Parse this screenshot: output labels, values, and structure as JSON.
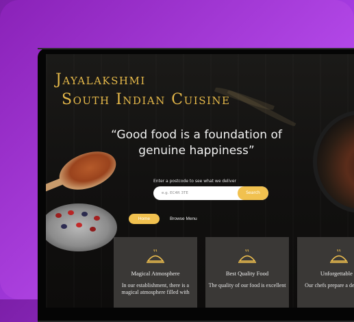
{
  "brand": {
    "line1": "Jayalakshmi",
    "line2": "South Indian Cuisine"
  },
  "hero": {
    "quote": "“Good food is a foundation of genuine happiness”"
  },
  "delivery": {
    "label": "Enter a postcode to see what we deliver",
    "placeholder": "e.g. EC4R 3TE",
    "button": "Search"
  },
  "nav": {
    "home": "Home",
    "browse": "Browse Menu"
  },
  "features": [
    {
      "icon": "cloche-icon",
      "title": "Magical Atmosphere",
      "desc": "In our establishment, there is a magical atmosphere filled with"
    },
    {
      "icon": "cloche-icon",
      "title": "Best Quality Food",
      "desc": "The quality of our food is excellent"
    },
    {
      "icon": "cloche-icon",
      "title": "Unforgettable T",
      "desc": "Our chefs prepare a delicious d"
    }
  ],
  "colors": {
    "accent": "#f1c14f",
    "brand_text": "#e6b94a",
    "background_gradient": [
      "#8a22b8",
      "#dc62ff"
    ],
    "card": "#3a3836"
  }
}
